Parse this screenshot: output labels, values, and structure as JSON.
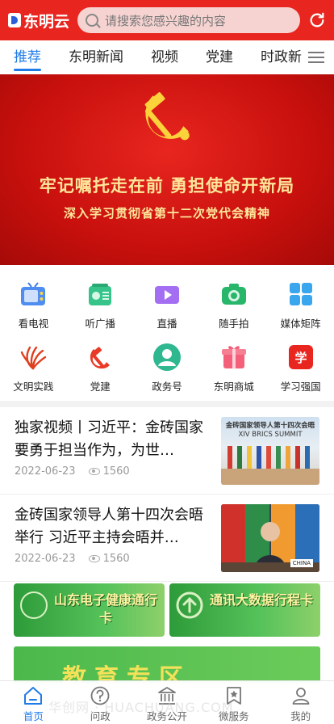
{
  "header": {
    "app_name": "东明云",
    "search_placeholder": "请搜索您感兴趣的内容"
  },
  "tabs": [
    {
      "label": "推荐",
      "active": true
    },
    {
      "label": "东明新闻",
      "active": false
    },
    {
      "label": "视频",
      "active": false
    },
    {
      "label": "党建",
      "active": false
    },
    {
      "label": "时政新",
      "active": false
    }
  ],
  "banner": {
    "title": "牢记嘱托走在前 勇担使命开新局",
    "subtitle": "深入学习贯彻省第十二次党代会精神"
  },
  "grid": [
    {
      "label": "看电视",
      "icon": "tv-icon"
    },
    {
      "label": "听广播",
      "icon": "radio-icon"
    },
    {
      "label": "直播",
      "icon": "live-icon"
    },
    {
      "label": "随手拍",
      "icon": "camera-icon"
    },
    {
      "label": "媒体矩阵",
      "icon": "matrix-icon"
    },
    {
      "label": "文明实践",
      "icon": "civilization-icon"
    },
    {
      "label": "党建",
      "icon": "party-icon"
    },
    {
      "label": "政务号",
      "icon": "gov-account-icon"
    },
    {
      "label": "东明商城",
      "icon": "mall-icon"
    },
    {
      "label": "学习强国",
      "icon": "xuexi-icon"
    }
  ],
  "news": [
    {
      "title": "独家视频丨习近平：金砖国家要勇于担当作为，为世…",
      "date": "2022-06-23",
      "views": "1560",
      "thumb_caption": "金砖国家领导人第十四次会晤",
      "thumb_caption2": "XIV BRICS SUMMIT"
    },
    {
      "title": "金砖国家领导人第十四次会晤举行 习近平主持会晤并…",
      "date": "2022-06-23",
      "views": "1560",
      "thumb_caption": "CHINA"
    }
  ],
  "cards": [
    {
      "text": "山东电子健康通行卡"
    },
    {
      "text": "通讯大数据行程卡"
    }
  ],
  "banner2": {
    "text": "教育专区"
  },
  "bottom_nav": [
    {
      "label": "首页",
      "active": true,
      "icon": "home-icon"
    },
    {
      "label": "问政",
      "active": false,
      "icon": "question-icon"
    },
    {
      "label": "政务公开",
      "active": false,
      "icon": "government-icon"
    },
    {
      "label": "微服务",
      "active": false,
      "icon": "service-icon"
    },
    {
      "label": "我的",
      "active": false,
      "icon": "user-icon"
    }
  ],
  "watermark": "华创网 · HUACHUANG.COM",
  "colors": {
    "brand_red": "#e8261f",
    "accent_blue": "#1f7be8",
    "banner_gold": "#fde69a"
  }
}
